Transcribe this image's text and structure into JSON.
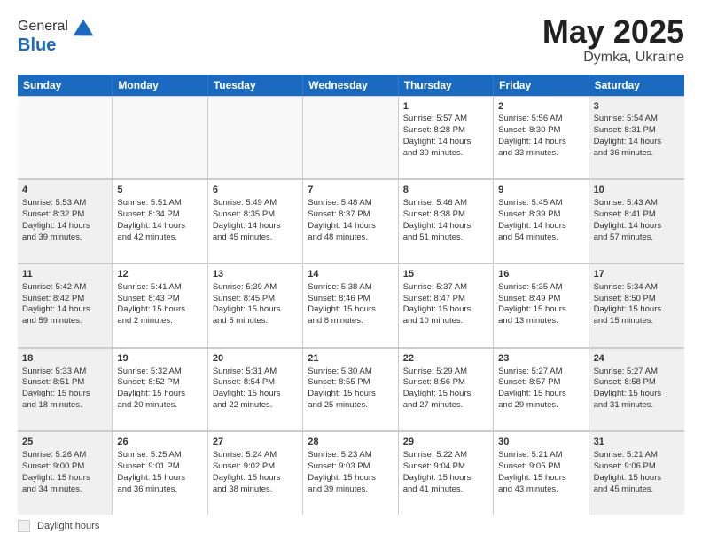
{
  "header": {
    "logo_general": "General",
    "logo_blue": "Blue",
    "title": "May 2025",
    "location": "Dymka, Ukraine"
  },
  "days_of_week": [
    "Sunday",
    "Monday",
    "Tuesday",
    "Wednesday",
    "Thursday",
    "Friday",
    "Saturday"
  ],
  "legend_label": "Daylight hours",
  "weeks": [
    [
      {
        "day": "",
        "content": "",
        "empty": true
      },
      {
        "day": "",
        "content": "",
        "empty": true
      },
      {
        "day": "",
        "content": "",
        "empty": true
      },
      {
        "day": "",
        "content": "",
        "empty": true
      },
      {
        "day": "1",
        "content": "Sunrise: 5:57 AM\nSunset: 8:28 PM\nDaylight: 14 hours\nand 30 minutes.",
        "empty": false
      },
      {
        "day": "2",
        "content": "Sunrise: 5:56 AM\nSunset: 8:30 PM\nDaylight: 14 hours\nand 33 minutes.",
        "empty": false
      },
      {
        "day": "3",
        "content": "Sunrise: 5:54 AM\nSunset: 8:31 PM\nDaylight: 14 hours\nand 36 minutes.",
        "empty": false
      }
    ],
    [
      {
        "day": "4",
        "content": "Sunrise: 5:53 AM\nSunset: 8:32 PM\nDaylight: 14 hours\nand 39 minutes.",
        "empty": false
      },
      {
        "day": "5",
        "content": "Sunrise: 5:51 AM\nSunset: 8:34 PM\nDaylight: 14 hours\nand 42 minutes.",
        "empty": false
      },
      {
        "day": "6",
        "content": "Sunrise: 5:49 AM\nSunset: 8:35 PM\nDaylight: 14 hours\nand 45 minutes.",
        "empty": false
      },
      {
        "day": "7",
        "content": "Sunrise: 5:48 AM\nSunset: 8:37 PM\nDaylight: 14 hours\nand 48 minutes.",
        "empty": false
      },
      {
        "day": "8",
        "content": "Sunrise: 5:46 AM\nSunset: 8:38 PM\nDaylight: 14 hours\nand 51 minutes.",
        "empty": false
      },
      {
        "day": "9",
        "content": "Sunrise: 5:45 AM\nSunset: 8:39 PM\nDaylight: 14 hours\nand 54 minutes.",
        "empty": false
      },
      {
        "day": "10",
        "content": "Sunrise: 5:43 AM\nSunset: 8:41 PM\nDaylight: 14 hours\nand 57 minutes.",
        "empty": false
      }
    ],
    [
      {
        "day": "11",
        "content": "Sunrise: 5:42 AM\nSunset: 8:42 PM\nDaylight: 14 hours\nand 59 minutes.",
        "empty": false
      },
      {
        "day": "12",
        "content": "Sunrise: 5:41 AM\nSunset: 8:43 PM\nDaylight: 15 hours\nand 2 minutes.",
        "empty": false
      },
      {
        "day": "13",
        "content": "Sunrise: 5:39 AM\nSunset: 8:45 PM\nDaylight: 15 hours\nand 5 minutes.",
        "empty": false
      },
      {
        "day": "14",
        "content": "Sunrise: 5:38 AM\nSunset: 8:46 PM\nDaylight: 15 hours\nand 8 minutes.",
        "empty": false
      },
      {
        "day": "15",
        "content": "Sunrise: 5:37 AM\nSunset: 8:47 PM\nDaylight: 15 hours\nand 10 minutes.",
        "empty": false
      },
      {
        "day": "16",
        "content": "Sunrise: 5:35 AM\nSunset: 8:49 PM\nDaylight: 15 hours\nand 13 minutes.",
        "empty": false
      },
      {
        "day": "17",
        "content": "Sunrise: 5:34 AM\nSunset: 8:50 PM\nDaylight: 15 hours\nand 15 minutes.",
        "empty": false
      }
    ],
    [
      {
        "day": "18",
        "content": "Sunrise: 5:33 AM\nSunset: 8:51 PM\nDaylight: 15 hours\nand 18 minutes.",
        "empty": false
      },
      {
        "day": "19",
        "content": "Sunrise: 5:32 AM\nSunset: 8:52 PM\nDaylight: 15 hours\nand 20 minutes.",
        "empty": false
      },
      {
        "day": "20",
        "content": "Sunrise: 5:31 AM\nSunset: 8:54 PM\nDaylight: 15 hours\nand 22 minutes.",
        "empty": false
      },
      {
        "day": "21",
        "content": "Sunrise: 5:30 AM\nSunset: 8:55 PM\nDaylight: 15 hours\nand 25 minutes.",
        "empty": false
      },
      {
        "day": "22",
        "content": "Sunrise: 5:29 AM\nSunset: 8:56 PM\nDaylight: 15 hours\nand 27 minutes.",
        "empty": false
      },
      {
        "day": "23",
        "content": "Sunrise: 5:27 AM\nSunset: 8:57 PM\nDaylight: 15 hours\nand 29 minutes.",
        "empty": false
      },
      {
        "day": "24",
        "content": "Sunrise: 5:27 AM\nSunset: 8:58 PM\nDaylight: 15 hours\nand 31 minutes.",
        "empty": false
      }
    ],
    [
      {
        "day": "25",
        "content": "Sunrise: 5:26 AM\nSunset: 9:00 PM\nDaylight: 15 hours\nand 34 minutes.",
        "empty": false
      },
      {
        "day": "26",
        "content": "Sunrise: 5:25 AM\nSunset: 9:01 PM\nDaylight: 15 hours\nand 36 minutes.",
        "empty": false
      },
      {
        "day": "27",
        "content": "Sunrise: 5:24 AM\nSunset: 9:02 PM\nDaylight: 15 hours\nand 38 minutes.",
        "empty": false
      },
      {
        "day": "28",
        "content": "Sunrise: 5:23 AM\nSunset: 9:03 PM\nDaylight: 15 hours\nand 39 minutes.",
        "empty": false
      },
      {
        "day": "29",
        "content": "Sunrise: 5:22 AM\nSunset: 9:04 PM\nDaylight: 15 hours\nand 41 minutes.",
        "empty": false
      },
      {
        "day": "30",
        "content": "Sunrise: 5:21 AM\nSunset: 9:05 PM\nDaylight: 15 hours\nand 43 minutes.",
        "empty": false
      },
      {
        "day": "31",
        "content": "Sunrise: 5:21 AM\nSunset: 9:06 PM\nDaylight: 15 hours\nand 45 minutes.",
        "empty": false
      }
    ]
  ]
}
